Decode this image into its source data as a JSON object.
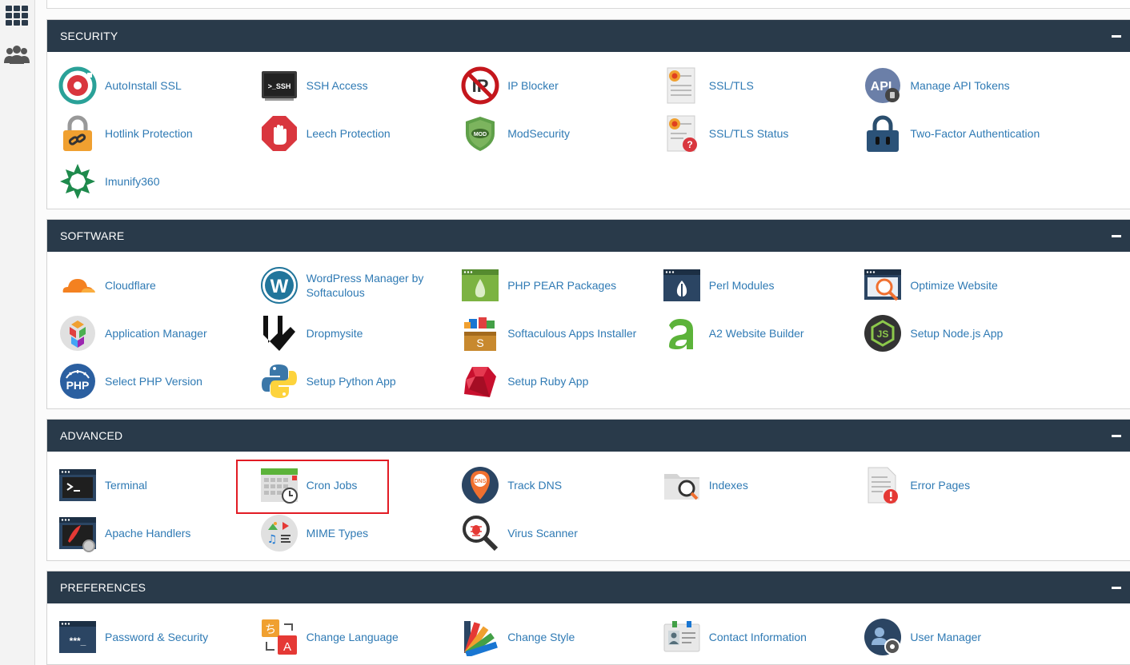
{
  "sidebar": {
    "items": [
      {
        "name": "grid-icon",
        "label": ""
      },
      {
        "name": "users-icon",
        "label": ""
      }
    ]
  },
  "sections": [
    {
      "title": "SECURITY",
      "rows": [
        [
          "AutoInstall SSL",
          "SSH Access",
          "IP Blocker",
          "SSL/TLS",
          "Manage API Tokens"
        ],
        [
          "Hotlink Protection",
          "Leech Protection",
          "ModSecurity",
          "SSL/TLS Status",
          "Two-Factor Authentication"
        ],
        [
          "Imunify360"
        ]
      ]
    },
    {
      "title": "SOFTWARE",
      "rows": [
        [
          "Cloudflare",
          "WordPress Manager by Softaculous",
          "PHP PEAR Packages",
          "Perl Modules",
          "Optimize Website"
        ],
        [
          "Application Manager",
          "Dropmysite",
          "Softaculous Apps Installer",
          "A2 Website Builder",
          "Setup Node.js App"
        ],
        [
          "Select PHP Version",
          "Setup Python App",
          "Setup Ruby App"
        ]
      ]
    },
    {
      "title": "ADVANCED",
      "rows": [
        [
          "Terminal",
          "Cron Jobs",
          "Track DNS",
          "Indexes",
          "Error Pages"
        ],
        [
          "Apache Handlers",
          "MIME Types",
          "Virus Scanner"
        ]
      ]
    },
    {
      "title": "PREFERENCES",
      "rows": [
        [
          "Password & Security",
          "Change Language",
          "Change Style",
          "Contact Information",
          "User Manager"
        ]
      ]
    }
  ],
  "icon_text": {
    "ssh": ">_SSH",
    "ip": "IP",
    "api": "API",
    "mod": "MOD",
    "php": "PHP",
    "dns": "DNS",
    "js": "JS",
    "password": "***_",
    "lang_a": "A",
    "lang_b": "ち"
  },
  "highlight": {
    "section": 2,
    "row": 0,
    "col": 1
  },
  "colors": {
    "header_bg": "#293a4a",
    "link": "#2f7ab4",
    "highlight": "#e21b24"
  }
}
